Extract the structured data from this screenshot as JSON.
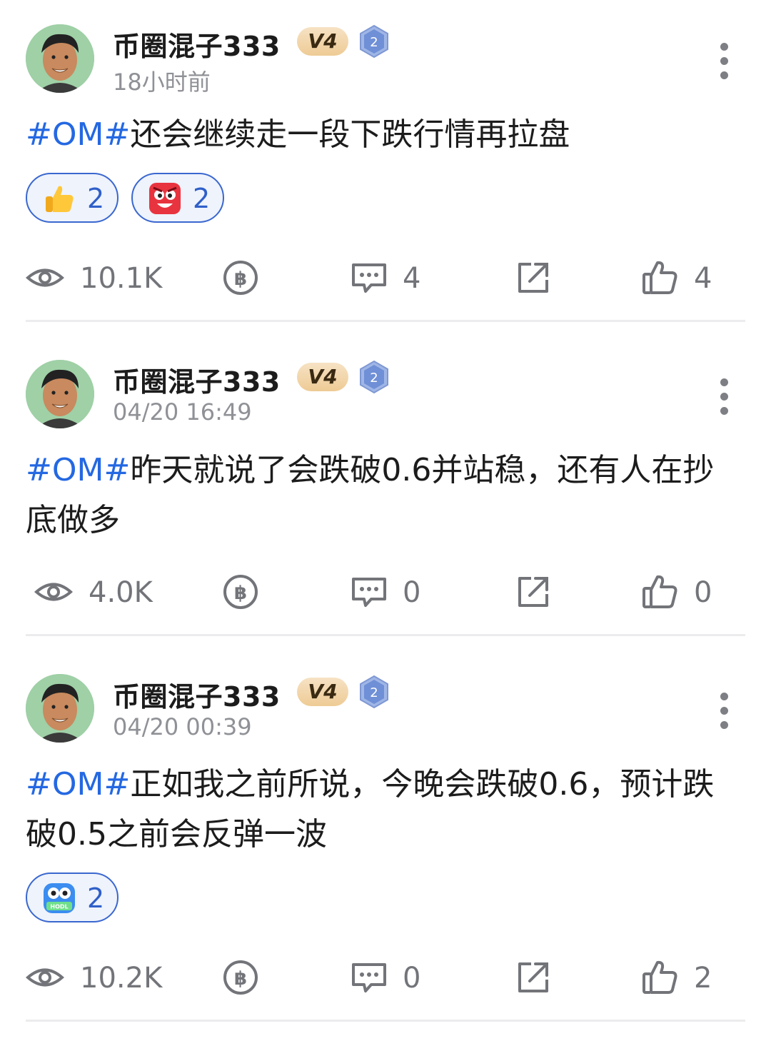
{
  "posts": [
    {
      "username": "币圈混子333",
      "vip_badge": "V4",
      "level": "2",
      "time": "18小时前",
      "hashtag": "#OM#",
      "text": "还会继续走一段下跌行情再拉盘",
      "reactions": [
        {
          "icon": "thumbs-up-emoji-icon",
          "count": "2"
        },
        {
          "icon": "angry-face-emoji-icon",
          "count": "2"
        }
      ],
      "stats": {
        "views": "10.1K",
        "comments": "4",
        "likes": "4"
      }
    },
    {
      "username": "币圈混子333",
      "vip_badge": "V4",
      "level": "2",
      "time": "04/20 16:49",
      "hashtag": "#OM#",
      "text": "昨天就说了会跌破0.6并站稳，还有人在抄底做多",
      "reactions": [],
      "stats": {
        "views": "4.0K",
        "comments": "0",
        "likes": "0"
      }
    },
    {
      "username": "币圈混子333",
      "vip_badge": "V4",
      "level": "2",
      "time": "04/20 00:39",
      "hashtag": "#OM#",
      "text": "正如我之前所说，今晚会跌破0.6，预计跌破0.5之前会反弹一波",
      "reactions": [
        {
          "icon": "hodl-owl-emoji-icon",
          "count": "2"
        }
      ],
      "stats": {
        "views": "10.2K",
        "comments": "0",
        "likes": "2"
      }
    }
  ],
  "hodl_label": "HODL",
  "colors": {
    "hashtag": "#2468e2",
    "reaction_border": "#3a67cf",
    "meta_gray": "#8f9196"
  }
}
